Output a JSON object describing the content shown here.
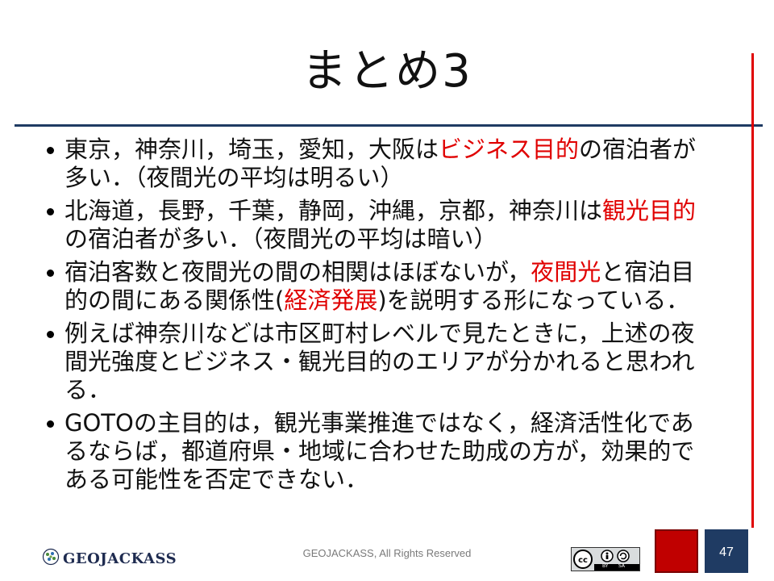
{
  "slide": {
    "title": "まとめ3",
    "bullets": [
      {
        "parts": [
          {
            "t": "東京，神奈川，埼玉，愛知，大阪は"
          },
          {
            "t": "ビジネス目的",
            "red": true
          },
          {
            "t": "の宿泊者が多い．（夜間光の平均は明るい）"
          }
        ]
      },
      {
        "parts": [
          {
            "t": "北海道，長野，千葉，静岡，沖縄，京都，神奈川は"
          },
          {
            "t": "観光目的",
            "red": true
          },
          {
            "t": "の宿泊者が多い．（夜間光の平均は暗い）"
          }
        ]
      },
      {
        "parts": [
          {
            "t": "宿泊客数と夜間光の間の相関はほぼないが，"
          },
          {
            "t": "夜間光",
            "red": true
          },
          {
            "t": "と宿泊目的の間にある関係性("
          },
          {
            "t": "経済発展",
            "red": true
          },
          {
            "t": ")を説明する形になっている．"
          }
        ]
      },
      {
        "parts": [
          {
            "t": "例えば神奈川などは市区町村レベルで見たときに，上述の夜間光強度とビジネス・観光目的のエリアが分かれると思われる．"
          }
        ]
      },
      {
        "parts": [
          {
            "t": "GOTOの主目的は，観光事業推進ではなく，経済活性化であるならば，都道府県・地域に合わせた助成の方が，効果的である可能性を否定できない．"
          }
        ]
      }
    ]
  },
  "footer": {
    "logo_text": "GEOJACKASS",
    "copyright": "GEOJACKASS, All Rights Reserved",
    "license_labels": [
      "BY",
      "SA"
    ],
    "page_number": "47"
  },
  "colors": {
    "accent_red": "#e00000",
    "navy": "#1f3b63"
  },
  "icons": {
    "logo": "globe-icon",
    "license": "creative-commons-icon"
  }
}
